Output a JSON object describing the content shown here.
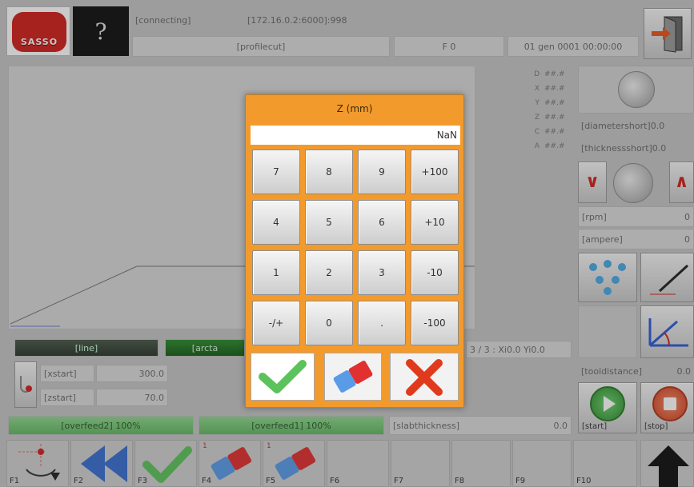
{
  "header": {
    "logo_text": "SASSO",
    "help_glyph": "?",
    "status": "[connecting]",
    "address": "[172.16.0.2:6000]:998",
    "profile": "[profilecut]",
    "feed": "F 0",
    "job_info": "01 gen 0001 00:00:00"
  },
  "axes": [
    {
      "label": "D",
      "value": "##.#"
    },
    {
      "label": "X",
      "value": "##.#"
    },
    {
      "label": "Y",
      "value": "##.#"
    },
    {
      "label": "Z",
      "value": "##.#"
    },
    {
      "label": "C",
      "value": "##.#"
    },
    {
      "label": "A",
      "value": "##.#"
    }
  ],
  "right_panel": {
    "diametershort": "[diametershort]0.0",
    "thicknessshort": "[thicknessshort]0.0",
    "rpm_label": "[rpm]",
    "rpm_value": "0",
    "ampere_label": "[ampere]",
    "ampere_value": "0",
    "tooldistance": "[tooldistance]",
    "tooldistance_value": "0.0",
    "start_label": "[start]",
    "stop_label": "[stop]"
  },
  "main": {
    "tab_line": "[line]",
    "tab_arc": "[arcta",
    "status_right": "3 / 3 : Xi0.0 Yi0.0",
    "xstart_label": "[xstart]",
    "xstart_value": "300.0",
    "zstart_label": "[zstart]",
    "zstart_value": "70.0",
    "overfeed2": "[overfeed2] 100%",
    "overfeed1": "[overfeed1] 100%",
    "slab_label": "[slabthickness]",
    "slab_value": "0.0"
  },
  "fkeys": [
    "F1",
    "F2",
    "F3",
    "F4",
    "F5",
    "F6",
    "F7",
    "F8",
    "F9",
    "F10"
  ],
  "fkey_badges": {
    "f4": "1",
    "f5": "1"
  },
  "dialog": {
    "title": "Z (mm)",
    "value": "NaN",
    "keys": [
      [
        "7",
        "8",
        "9",
        "+100"
      ],
      [
        "4",
        "5",
        "6",
        "+10"
      ],
      [
        "1",
        "2",
        "3",
        "-10"
      ],
      [
        "-/+",
        "0",
        ".",
        "-100"
      ]
    ]
  },
  "colors": {
    "dialog_bg": "#f39a2c",
    "accent_green": "#5cc35c",
    "cancel_red": "#e03a1e",
    "logo_red": "#d0201c"
  },
  "icons": {
    "ok": "checkmark-icon",
    "clear": "eraser-icon",
    "cancel": "x-icon"
  }
}
